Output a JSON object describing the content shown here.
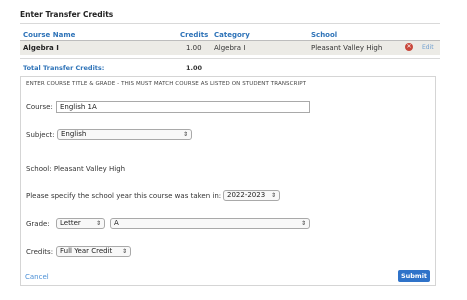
{
  "page_title": "Enter Transfer Credits",
  "table": {
    "headers": [
      "Course Name",
      "Credits",
      "Category",
      "School"
    ],
    "rows": [
      {
        "course": "Algebra I",
        "credits": "1.00",
        "category": "Algebra I",
        "school": "Pleasant Valley High",
        "action": "Edit"
      }
    ],
    "total_label": "Total Transfer Credits:",
    "total_value": "1.00"
  },
  "form": {
    "legend": "ENTER COURSE TITLE & GRADE - THIS MUST MATCH COURSE AS LISTED ON STUDENT TRANSCRIPT",
    "course_label": "Course:",
    "course_value": "English 1A",
    "subject_label": "Subject:",
    "subject_value": "English",
    "school_text": "School: Pleasant Valley High",
    "year_label": "Please specify the school year this course was taken in:",
    "year_value": "2022-2023",
    "grade_label": "Grade:",
    "grade_type_value": "Letter",
    "grade_value": "A",
    "credits_label": "Credits:",
    "credits_value": "Full Year Credit",
    "cancel": "Cancel",
    "submit": "Submit"
  },
  "colors": {
    "accent": "#2e73b8",
    "row_bg": "#ecebe6",
    "delete": "#c8473b",
    "submit": "#2f73c9"
  },
  "icons": [
    "delete-icon",
    "chevron-updown-icon"
  ]
}
